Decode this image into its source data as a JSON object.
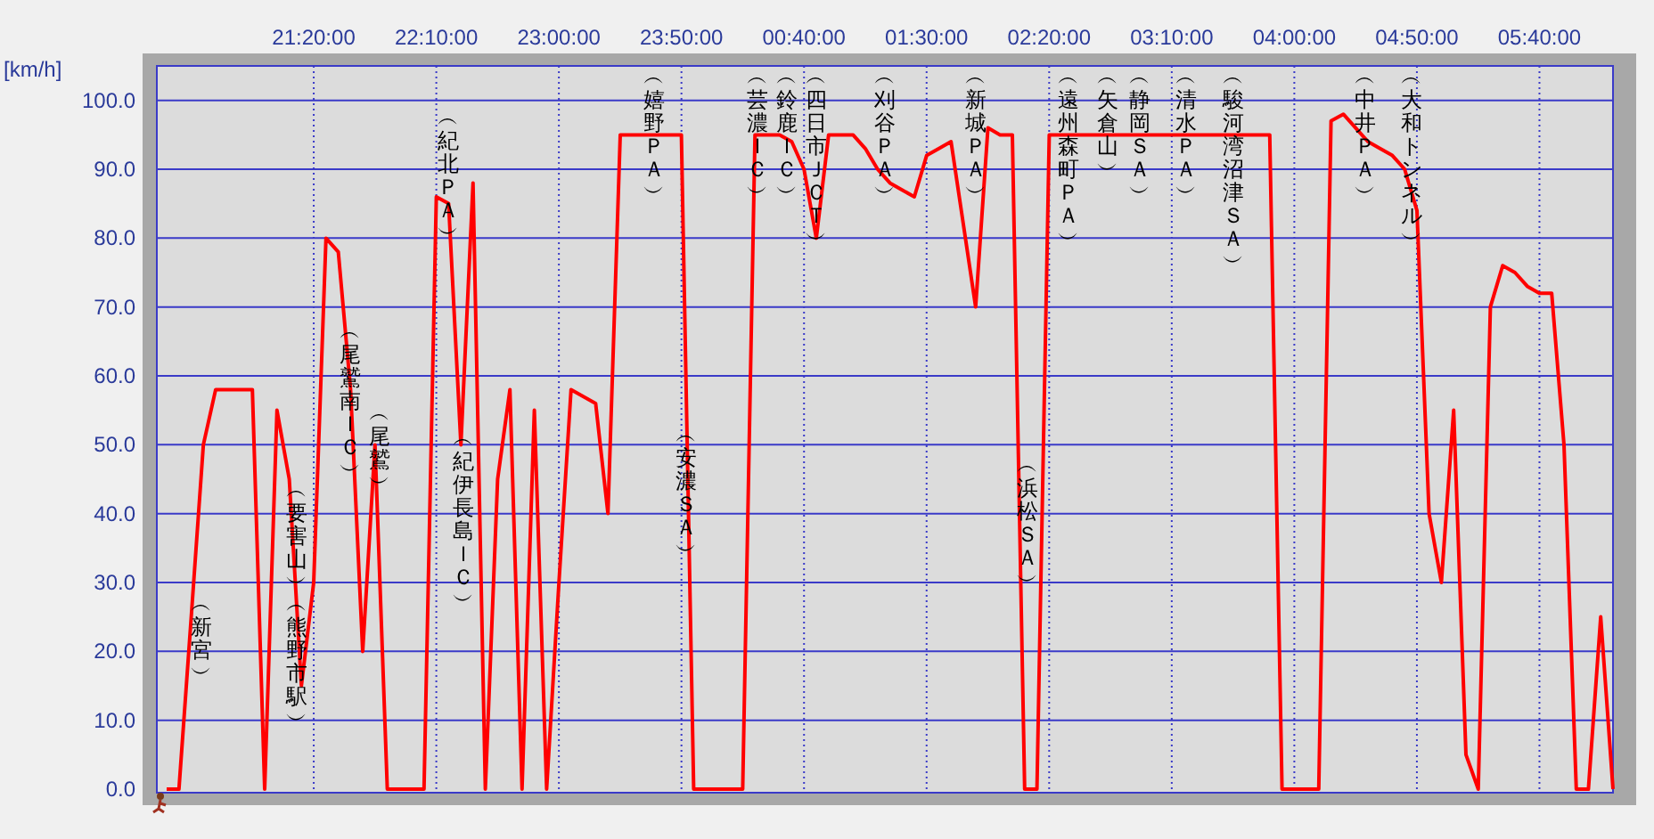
{
  "chart_data": {
    "type": "line",
    "grid": true,
    "ylabel": "[km/h]",
    "ylim": [
      0,
      105
    ],
    "categories": [
      null,
      null,
      null,
      null,
      null,
      null,
      null,
      null,
      null,
      null,
      null,
      null,
      "21:20:00",
      null,
      null,
      null,
      null,
      null,
      null,
      null,
      null,
      null,
      "22:10:00",
      null,
      null,
      null,
      null,
      null,
      null,
      null,
      null,
      null,
      "23:00:00",
      null,
      null,
      null,
      null,
      null,
      null,
      null,
      null,
      null,
      "23:50:00",
      null,
      null,
      null,
      null,
      null,
      null,
      null,
      null,
      null,
      "00:40:00",
      null,
      null,
      null,
      null,
      null,
      null,
      null,
      null,
      null,
      "01:30:00",
      null,
      null,
      null,
      null,
      null,
      null,
      null,
      null,
      null,
      "02:20:00",
      null,
      null,
      null,
      null,
      null,
      null,
      null,
      null,
      null,
      "03:10:00",
      null,
      null,
      null,
      null,
      null,
      null,
      null,
      null,
      null,
      "04:00:00",
      null,
      null,
      null,
      null,
      null,
      null,
      null,
      null,
      null,
      "04:50:00",
      null,
      null,
      null,
      null,
      null,
      null,
      null,
      null,
      null,
      "05:40:00",
      null,
      null,
      null,
      null,
      null,
      null
    ],
    "yticks": [
      {
        "value": 0,
        "label": "0.0"
      },
      {
        "value": 10,
        "label": "10.0"
      },
      {
        "value": 20,
        "label": "20.0"
      },
      {
        "value": 30,
        "label": "30.0"
      },
      {
        "value": 40,
        "label": "40.0"
      },
      {
        "value": 50,
        "label": "50.0"
      },
      {
        "value": 60,
        "label": "60.0"
      },
      {
        "value": 70,
        "label": "70.0"
      },
      {
        "value": 80,
        "label": "80.0"
      },
      {
        "value": 90,
        "label": "90.0"
      },
      {
        "value": 100,
        "label": "100.0"
      }
    ],
    "series": [
      {
        "color": "#ff0000",
        "values": [
          0,
          0,
          25,
          50,
          58,
          58,
          58,
          58,
          0,
          55,
          45,
          15,
          30,
          80,
          78,
          58,
          20,
          50,
          0,
          0,
          0,
          0,
          86,
          85,
          50,
          88,
          0,
          45,
          58,
          0,
          55,
          0,
          30,
          58,
          57,
          56,
          40,
          95,
          95,
          95,
          95,
          95,
          95,
          0,
          0,
          0,
          0,
          0,
          95,
          95,
          95,
          94,
          90,
          80,
          95,
          95,
          95,
          93,
          90,
          88,
          87,
          86,
          92,
          93,
          94,
          82,
          70,
          96,
          95,
          95,
          0,
          0,
          95,
          95,
          95,
          95,
          95,
          95,
          95,
          95,
          95,
          95,
          95,
          95,
          95,
          95,
          95,
          95,
          95,
          95,
          95,
          0,
          0,
          0,
          0,
          97,
          98,
          96,
          94,
          93,
          92,
          90,
          84,
          40,
          30,
          55,
          5,
          0,
          70,
          76,
          75,
          73,
          72,
          72,
          50,
          0,
          0,
          25,
          0
        ]
      }
    ],
    "annotations": [
      "︵新宮︶",
      "︵要害山︶",
      "︵熊野市駅︶",
      "︵尾鷲南ＩＣ︶",
      "︵尾鷲︶",
      "︵紀北ＰＡ︶",
      "︵紀伊長島ＩＣ︶",
      "︵嬉野ＰＡ︶",
      "︵安濃ＳＡ︶",
      "︵芸濃ＩＣ︶",
      "︵鈴鹿ＩＣ︶",
      "︵四日市ＪＣＴ︶",
      "︵刈谷ＰＡ︶",
      "︵新城ＰＡ︶",
      "︵浜松ＳＡ︶",
      "︵遠州森町ＰＡ︶",
      "︵矢倉山︶",
      "︵静岡ＳＡ︶",
      "︵清水ＰＡ︶",
      "︵駿河湾沼津ＳＡ︶",
      "︵中井ＰＡ︶",
      "︵大和トンネル︶"
    ]
  }
}
